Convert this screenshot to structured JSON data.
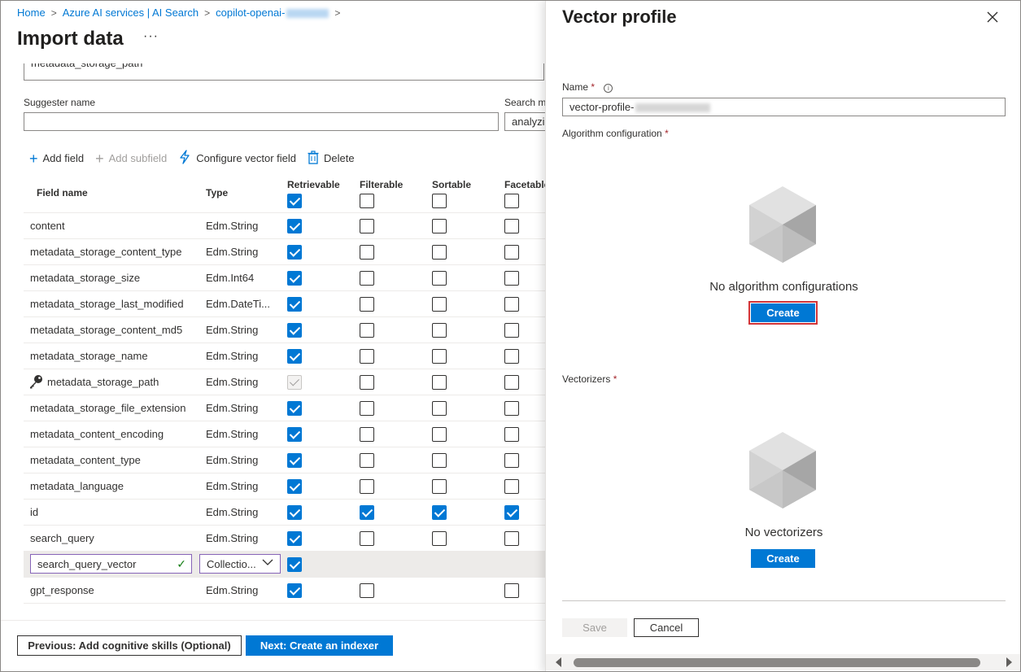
{
  "breadcrumb": {
    "items": [
      "Home",
      "Azure AI services | AI Search",
      "copilot-openai-"
    ]
  },
  "page": {
    "title": "Import data",
    "more": "···"
  },
  "form": {
    "cut_field_value": "metadata_storage_path",
    "suggester_label": "Suggester name",
    "suggester_value": "",
    "search_mode_label": "Search m",
    "search_mode_value": "analyzi"
  },
  "toolbar": {
    "add_field": "Add field",
    "add_subfield": "Add subfield",
    "configure_vector": "Configure vector field",
    "delete": "Delete"
  },
  "grid": {
    "columns": [
      "Field name",
      "Type",
      "Retrievable",
      "Filterable",
      "Sortable",
      "Facetable"
    ],
    "header_checks": [
      true,
      false,
      false,
      false
    ],
    "rows": [
      {
        "name": "content",
        "type": "Edm.String",
        "checks": [
          true,
          false,
          false,
          false
        ]
      },
      {
        "name": "metadata_storage_content_type",
        "type": "Edm.String",
        "checks": [
          true,
          false,
          false,
          false
        ]
      },
      {
        "name": "metadata_storage_size",
        "type": "Edm.Int64",
        "checks": [
          true,
          false,
          false,
          false
        ]
      },
      {
        "name": "metadata_storage_last_modified",
        "type": "Edm.DateTi...",
        "checks": [
          true,
          false,
          false,
          false
        ]
      },
      {
        "name": "metadata_storage_content_md5",
        "type": "Edm.String",
        "checks": [
          true,
          false,
          false,
          false
        ]
      },
      {
        "name": "metadata_storage_name",
        "type": "Edm.String",
        "checks": [
          true,
          false,
          false,
          false
        ]
      },
      {
        "name": "metadata_storage_path",
        "type": "Edm.String",
        "checks": [
          "disabled",
          false,
          false,
          false
        ],
        "key": true
      },
      {
        "name": "metadata_storage_file_extension",
        "type": "Edm.String",
        "checks": [
          true,
          false,
          false,
          false
        ]
      },
      {
        "name": "metadata_content_encoding",
        "type": "Edm.String",
        "checks": [
          true,
          false,
          false,
          false
        ]
      },
      {
        "name": "metadata_content_type",
        "type": "Edm.String",
        "checks": [
          true,
          false,
          false,
          false
        ]
      },
      {
        "name": "metadata_language",
        "type": "Edm.String",
        "checks": [
          true,
          false,
          false,
          false
        ]
      },
      {
        "name": "id",
        "type": "Edm.String",
        "checks": [
          true,
          true,
          true,
          true
        ]
      },
      {
        "name": "search_query",
        "type": "Edm.String",
        "checks": [
          true,
          false,
          false,
          false
        ]
      },
      {
        "name": "search_query_vector",
        "type": "Collectio...",
        "checks": [
          true,
          null,
          null,
          null
        ],
        "editing": true
      },
      {
        "name": "gpt_response",
        "type": "Edm.String",
        "checks": [
          true,
          false,
          null,
          false
        ]
      }
    ]
  },
  "footer": {
    "prev_label": "Previous: Add cognitive skills (Optional)",
    "next_label": "Next: Create an indexer"
  },
  "panel": {
    "title": "Vector profile",
    "name_label": "Name",
    "name_value": "vector-profile-",
    "algo_label": "Algorithm configuration",
    "algo_empty": "No algorithm configurations",
    "algo_create": "Create",
    "vectorizers_label": "Vectorizers",
    "vectorizers_empty": "No vectorizers",
    "vectorizers_create": "Create",
    "save_label": "Save",
    "cancel_label": "Cancel",
    "required_mark": "*"
  },
  "colors": {
    "accent": "#0078d4",
    "highlight": "#d13438"
  }
}
